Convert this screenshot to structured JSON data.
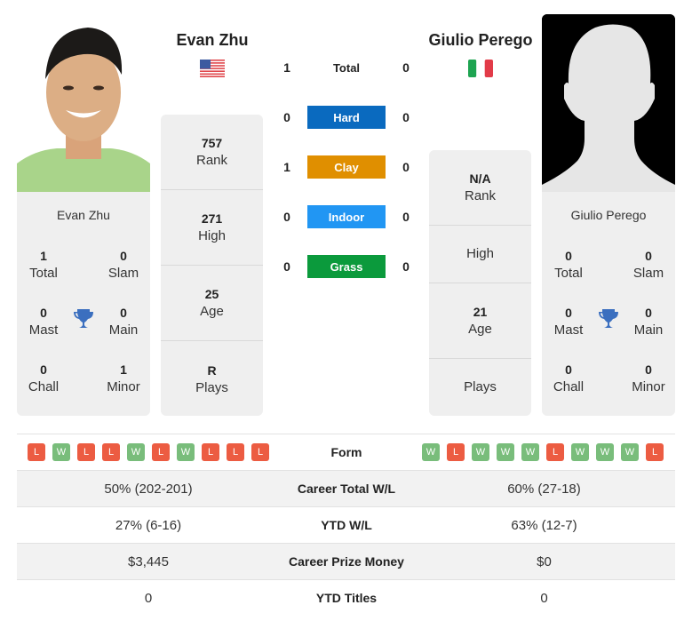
{
  "player1": {
    "name": "Evan Zhu",
    "country_flag": "usa-flag-icon",
    "card_name": "Evan Zhu",
    "titles": {
      "total": {
        "value": "1",
        "label": "Total"
      },
      "slam": {
        "value": "0",
        "label": "Slam"
      },
      "mast": {
        "value": "0",
        "label": "Mast"
      },
      "main": {
        "value": "0",
        "label": "Main"
      },
      "chall": {
        "value": "0",
        "label": "Chall"
      },
      "minor": {
        "value": "1",
        "label": "Minor"
      }
    },
    "profile": {
      "rank": {
        "value": "757",
        "label": "Rank"
      },
      "high": {
        "value": "271",
        "label": "High"
      },
      "age": {
        "value": "25",
        "label": "Age"
      },
      "plays": {
        "value": "R",
        "label": "Plays"
      }
    },
    "form": [
      "L",
      "W",
      "L",
      "L",
      "W",
      "L",
      "W",
      "L",
      "L",
      "L"
    ]
  },
  "player2": {
    "name": "Giulio Perego",
    "country_flag": "italy-flag-icon",
    "card_name": "Giulio Perego",
    "titles": {
      "total": {
        "value": "0",
        "label": "Total"
      },
      "slam": {
        "value": "0",
        "label": "Slam"
      },
      "mast": {
        "value": "0",
        "label": "Mast"
      },
      "main": {
        "value": "0",
        "label": "Main"
      },
      "chall": {
        "value": "0",
        "label": "Chall"
      },
      "minor": {
        "value": "0",
        "label": "Minor"
      }
    },
    "profile": {
      "rank": {
        "value": "N/A",
        "label": "Rank"
      },
      "high": {
        "value": "",
        "label": "High"
      },
      "age": {
        "value": "21",
        "label": "Age"
      },
      "plays": {
        "value": "",
        "label": "Plays"
      }
    },
    "form": [
      "W",
      "L",
      "W",
      "W",
      "W",
      "L",
      "W",
      "W",
      "W",
      "L"
    ]
  },
  "h2h": {
    "total": {
      "label": "Total",
      "p1": "1",
      "p2": "0"
    },
    "surfaces": [
      {
        "label": "Hard",
        "p1": "0",
        "p2": "0",
        "color": "#0a6abf"
      },
      {
        "label": "Clay",
        "p1": "1",
        "p2": "0",
        "color": "#e08f00"
      },
      {
        "label": "Indoor",
        "p1": "0",
        "p2": "0",
        "color": "#2196f3"
      },
      {
        "label": "Grass",
        "p1": "0",
        "p2": "0",
        "color": "#0b9a3c"
      }
    ]
  },
  "colors": {
    "win": "#79bd7b",
    "loss": "#ec5c42",
    "trophy": "#3b6fbf"
  },
  "comparison": {
    "form_label": "Form",
    "rows": [
      {
        "label": "Career Total W/L",
        "p1": "50% (202-201)",
        "p2": "60% (27-18)"
      },
      {
        "label": "YTD W/L",
        "p1": "27% (6-16)",
        "p2": "63% (12-7)"
      },
      {
        "label": "Career Prize Money",
        "p1": "$3,445",
        "p2": "$0"
      },
      {
        "label": "YTD Titles",
        "p1": "0",
        "p2": "0"
      }
    ]
  }
}
